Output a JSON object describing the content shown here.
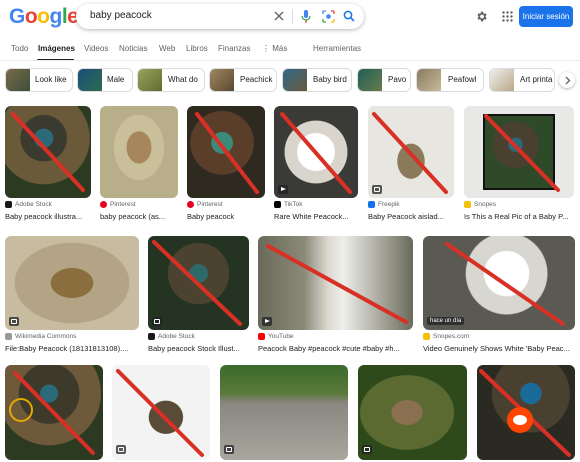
{
  "header": {
    "logo": "Google",
    "query": "baby peacock",
    "signin_label": "Iniciar sesión"
  },
  "tabs": [
    {
      "label": "Todo"
    },
    {
      "label": "Imágenes"
    },
    {
      "label": "Videos"
    },
    {
      "label": "Noticias"
    },
    {
      "label": "Web"
    },
    {
      "label": "Libros"
    },
    {
      "label": "Finanzas"
    },
    {
      "label": "⋮ Más"
    },
    {
      "label": "Herramientas"
    }
  ],
  "chips": [
    {
      "label": "Look like"
    },
    {
      "label": "Male"
    },
    {
      "label": "What do"
    },
    {
      "label": "Peachick"
    },
    {
      "label": "Baby bird"
    },
    {
      "label": "Pavo"
    },
    {
      "label": "Peafowl"
    },
    {
      "label": "Art printa"
    }
  ],
  "results": [
    {
      "source": "Adobe Stock",
      "title": "Baby peacock illustra..."
    },
    {
      "source": "Pinterest",
      "title": "baby peacock (as..."
    },
    {
      "source": "Pinterest",
      "title": "Baby peacock"
    },
    {
      "source": "TikTok",
      "title": "Rare White Peacock..."
    },
    {
      "source": "Freepik",
      "title": "Baby Peacock aislad..."
    },
    {
      "source": "Snopes",
      "title": "Is This a Real Pic of a Baby P..."
    },
    {
      "source": "Wikimedia Commons",
      "title": "File:Baby Peacock (18131813108)...."
    },
    {
      "source": "Adobe Stock",
      "title": "Baby peacock Stock Illust..."
    },
    {
      "source": "YouTube",
      "title": "Peacock Baby #peacock #cute #baby #h..."
    },
    {
      "source": "Snopes.com",
      "title": "Video Genuinely Shows White 'Baby Peac..."
    },
    {
      "source": "",
      "title": ""
    },
    {
      "source": "",
      "title": ""
    },
    {
      "source": "",
      "title": ""
    },
    {
      "source": "",
      "title": ""
    },
    {
      "source": "",
      "title": ""
    }
  ],
  "overlay": {
    "hace_un_dia": "hace un día"
  },
  "colors": {
    "accent": "#1a73e8",
    "strike": "#d93025"
  }
}
